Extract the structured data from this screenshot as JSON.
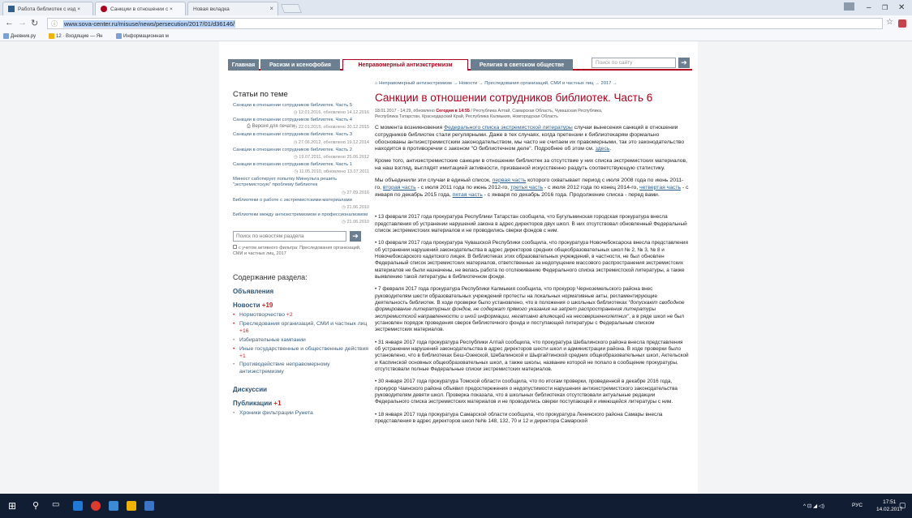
{
  "browser": {
    "tabs": [
      {
        "label": "Работа библиотек с изд ×",
        "icon": "shield-favicon",
        "active": false
      },
      {
        "label": "Санкции в отношении с ×",
        "icon": "sova-favicon",
        "active": true
      },
      {
        "label": "Новая вкладка",
        "icon": "",
        "active": false
      }
    ],
    "url": "www.sova-center.ru/misuse/news/persecution/2017/01/d36146/",
    "bookmarks": [
      {
        "label": "Дневник.ру",
        "color": "#7aa2d6"
      },
      {
        "label": "12 · Входящие — Ян",
        "color": "#f0b400"
      },
      {
        "label": "Информационная м",
        "color": "#7aa2d6"
      }
    ]
  },
  "site": {
    "nav": [
      {
        "label": "Главная",
        "active": false
      },
      {
        "label": "Расизм и ксенофобия",
        "active": false
      },
      {
        "label": "Неправомерный антиэкстремизм",
        "active": true
      },
      {
        "label": "Религия в светском обществе",
        "active": false
      }
    ],
    "search_placeholder": "Поиск по сайту",
    "accent": "#b0001e"
  },
  "sidebar": {
    "heading": "Статьи по теме",
    "articles": [
      {
        "title": "Санкции в отношении сотрудников библиотек. Часть 5",
        "date": "12.01.2016, обновлено 14.12.2016"
      },
      {
        "title": "Санкции в отношении сотрудников библиотек. Часть 4",
        "date": "22.01.2015, обновлено 30.12.2015"
      },
      {
        "title": "Санкции в отношении сотрудников библиотек. Часть 3",
        "date": "27.06.2012, обновлено 19.12.2014"
      },
      {
        "title": "Санкции в отношении сотрудников библиотек. Часть 2",
        "date": "19.07.2011, обновлено 25.06.2012"
      },
      {
        "title": "Санкции в отношении сотрудников библиотек. Часть 1",
        "date": "11.05.2010, обновлено 13.07.2011"
      },
      {
        "title": "Минюст саботирует попытку Минкульта решить \"экстремистскую\" проблему библиотек",
        "date": "27.09.2016"
      },
      {
        "title": "Библиотеки о работе с экстремистскими материалами",
        "date": "21.06.2010"
      },
      {
        "title": "Библиотеки между антиэкстремизмом и профессионализмом",
        "date": "21.06.2010"
      }
    ],
    "news_search_placeholder": "Поиск по новостям раздела",
    "filter_text": "с учетом активного фильтра: Преследования организаций, СМИ и частных лиц, 2017",
    "toc_heading": "Содержание раздела:",
    "announcements": "Объявления",
    "news_label": "Новости",
    "news_count": "+19",
    "news_items": [
      {
        "label": "Нормотворчество",
        "count": "+2",
        "grey": false
      },
      {
        "label": "Преследования организаций, СМИ и частных лиц",
        "count": "+16",
        "grey": false
      },
      {
        "label": "Избирательные кампании",
        "count": "",
        "grey": true
      },
      {
        "label": "Иные государственные и общественные действия",
        "count": "+1",
        "grey": false
      },
      {
        "label": "Противодействие неправомерному антиэкстремизму",
        "count": "",
        "grey": true
      }
    ],
    "discussions": "Дискуссии",
    "publications_label": "Публикации",
    "publications_count": "+1",
    "pub_items": [
      {
        "label": "Хроники фильтрации Рунета",
        "count": "",
        "grey": true
      }
    ]
  },
  "article": {
    "breadcrumbs": "Неправомерный антиэкстремизм → Новости → Преследования организаций, СМИ и частных лиц → 2017 →",
    "title": "Санкции в отношении сотрудников библиотек. Часть 6",
    "meta_date": "18.01.2017 - 14:29, обновлено",
    "meta_updated": "Сегодня в 14:55",
    "meta_regions": "/ Республика Алтай, Самарская Область, Чувашская Республика, Республика Татарстан, Краснодарский Край, Республика Калмыкия, Новгородская Область",
    "print_label": "Версия для печати",
    "intro_1_a": "С момента возникновения",
    "intro_1_link": "Федерального списка экстремистской литературы",
    "intro_1_b": "случаи вынесения санкций в отношении сотрудников библиотек стали регулярными. Даже в тех случаях, когда претензии к библиотекарям формально обоснованы антиэкстремистским законодательством, мы часто не считаем их правомерными, так это законодательство находится в противоречии с законом \"О библиотечном деле\". Подробнее об этом см.",
    "intro_1_link2": "здесь",
    "intro_2": "Кроме того, антиэкстремистские санкции в отношении библиотек за отсутствие у них списка экстремистских материалов, на наш взгляд, выглядят имитацией активности, призванной искусственно раздуть соответствующую статистику.",
    "intro_3_a": "Мы объединили эти случаи в единый список,",
    "intro_3_l1": "первая часть",
    "intro_3_b": "которого охватывает период с июля 2008 года по июнь 2011-го,",
    "intro_3_l2": "вторая часть",
    "intro_3_c": "- с июля 2011 года по июнь 2012-го,",
    "intro_3_l3": "третья часть",
    "intro_3_d": "- с июля 2012 года по конец 2014-го,",
    "intro_3_l4": "четвертая часть",
    "intro_3_e": "- с января по декабрь 2015 года,",
    "intro_3_l5": "пятая часть",
    "intro_3_f": "- с января по декабрь 2016 года. Продолжение списка - перед вами.",
    "news_1": "13 февраля 2017 года прокуратура Республики Татарстан сообщила, что Бугульминская городская прокуратура внесла представления об устранении нарушений закона в адрес директоров двух школ. В них отсутствовал обновленный Федеральный список экстремистских материалов и не проводились сверки фондов с ним.",
    "news_2": "10 февраля 2017 года прокуратура Чувашской Республики сообщила, что прокуратура Новочебоксарска внесла представления об устранении нарушений законодательства в адрес директоров средних общеобразовательных школ № 2, № 3, № 8 и Новочебоксарского кадетского лицея. В библиотеках этих образовательных учреждений, в частности, не был обновлен Федеральный список экстремистских материалов, ответственные за недопущение массового распространения экстремистских материалов не были назначены, не велась работа по отслеживанию Федерального списка экстремистской литературы, а также выявлению такой литературы в библиотечном фонде.",
    "news_3_a": "7 февраля 2017 года прокуратура Республики Калмыкия сообщила, что прокурор Черноземельского района внес руководителям шести образовательных учреждений протесты на локальных нормативные акты, регламентирующие деятельность библиотек. В ходе проверки было установлено, что в положения о школьных библиотеках",
    "news_3_i": "\"допускают свободное формирование литературных фондов, не содержат прямого указания на запрет распространения литературы экстремистской направленности и иной информации, негативно влияющей на несовершеннолетних\"",
    "news_3_b": ", а в ряде школ не был установлен порядок проведения сверок библиотечного фонда и поступающей литературы с Федеральным списком экстремистских материалов.",
    "news_4": "31 января 2017 года прокуратура Республики Алтай сообщила, что прокуратура Шебалинского района внесла представления об устранении нарушений законодательства в адрес директоров шести школ и администрации района. В ходе проверки было установлено, что в библиотеках Беш-Озекской, Шебалинской и Шыргайтинской средних общеобразовательных школ, Актельской и Каспинской основных общеобразовательных школ, а также школы, название которой не попало в сообщение прокуратуры, отсутствовали полные Федеральные списки экстремистских материалов.",
    "news_5": "30 января 2017 года прокуратура Томской области сообщила, что по итогам проверки, проведенной в декабре 2016 года, прокурор Чаинского района объявил предостережения о недопустимости нарушения антиэкстремистского законодательства руководителям девяти школ. Проверка показала, что в школьных библиотеках отсутствовали актуальные редакции Федерального списка экстремистских материалов и не проводились сверки поступающей и имеющейся литературы с ним.",
    "news_6": "18 января 2017 года прокуратура Самарской области сообщила, что прокуратура Ленинского района Самары внесла представления в адрес директоров школ №№ 148, 132, 70 и 12 и директора Самарской"
  },
  "taskbar": {
    "lang": "РУС",
    "time": "17:51",
    "date": "14.02.2017"
  }
}
